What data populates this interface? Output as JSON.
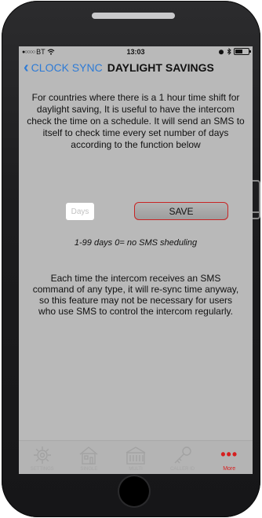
{
  "status": {
    "carrier": "BT",
    "time": "13:03"
  },
  "nav": {
    "back_label": "CLOCK SYNC",
    "title": "DAYLIGHT SAVINGS"
  },
  "description": "For countries where there is a 1 hour time shift for daylight saving, It is useful to have the intercom check the time on a schedule. It will send an SMS to itself to check time every set number of days according to the function below",
  "days_input": {
    "placeholder": "Days",
    "value": ""
  },
  "save_label": "SAVE",
  "hint": "1-99 days   0= no SMS sheduling",
  "note": "Each time the intercom receives an SMS command of any type, it will re-sync time anyway, so this feature may not be necessary for users who use SMS to control the intercom regularly.",
  "tabs": [
    {
      "label": "SETTINGS",
      "icon": "gear-icon"
    },
    {
      "label": "SINGLE",
      "icon": "house-icon"
    },
    {
      "label": "MULTI",
      "icon": "building-icon"
    },
    {
      "label": "CALLER ID",
      "icon": "key-icon"
    },
    {
      "label": "More",
      "icon": "more-icon",
      "active": true
    }
  ],
  "colors": {
    "screen_bg": "#b9b9b9",
    "accent_blue": "#2e7bd6",
    "accent_red": "#d61f1f"
  }
}
